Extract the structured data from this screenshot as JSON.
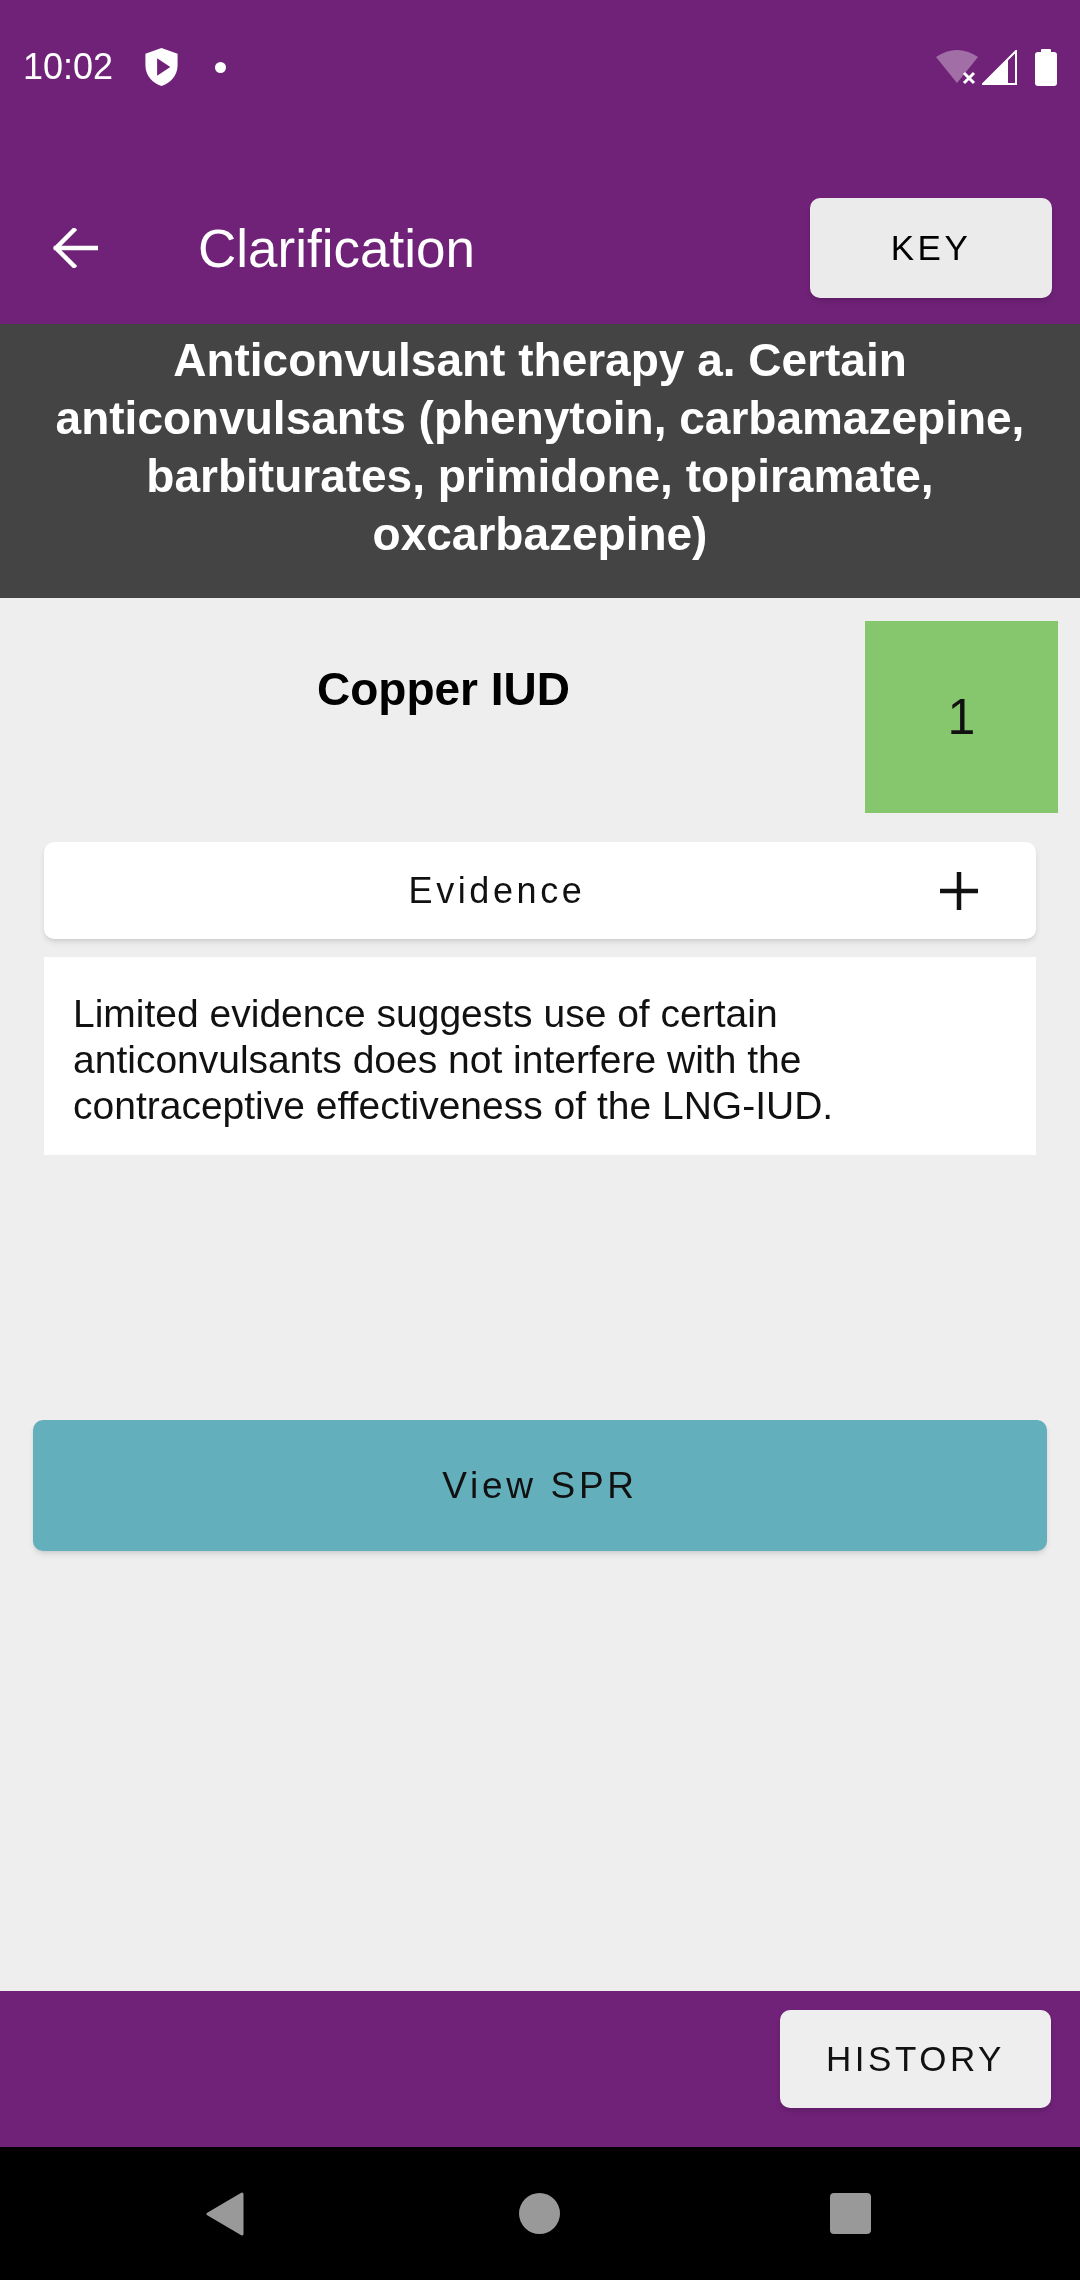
{
  "status_bar": {
    "time": "10:02"
  },
  "app_bar": {
    "title": "Clarification",
    "key_button": "KEY"
  },
  "condition": {
    "title": "Anticonvulsant therapy a. Certain anticonvulsants (phenytoin, carbamazepine, barbiturates, primidone, topiramate, oxcarbazepine)"
  },
  "method": {
    "name": "Copper IUD",
    "category": "1"
  },
  "evidence": {
    "label": "Evidence",
    "text": "Limited evidence suggests use of certain anticonvulsants does not interfere with the contraceptive effectiveness of the LNG-IUD."
  },
  "view_button": "View SPR",
  "bottom_bar": {
    "history_button": "HISTORY"
  }
}
